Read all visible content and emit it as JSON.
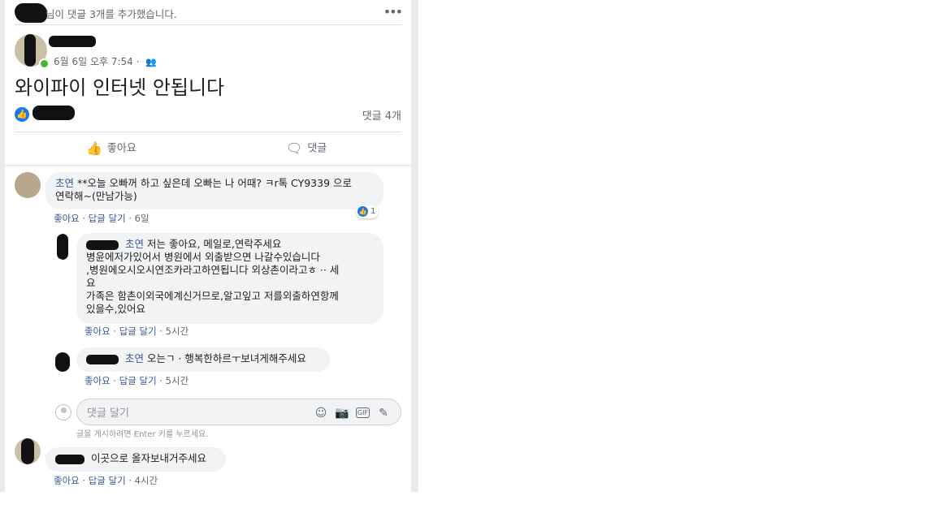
{
  "activity": {
    "text": "님이 댓글 3개를 추가했습니다.",
    "more": "•••"
  },
  "post": {
    "timestamp": "6월 6일 오후 7:54 · ",
    "audience_icon": "friends-icon",
    "text": "와이파이 인터넷 안됩니다",
    "comment_count": "댓글 4개",
    "actions": {
      "like": "좋아요",
      "comment": "댓글"
    }
  },
  "comments": [
    {
      "author": "초연",
      "text_line1": "**오늘 오빠꺼 하고 싶은데 오빠는 나 어때? ㅋr톡 CY9339 으로",
      "text_line2": "연락해~(만남가능)",
      "like": "좋아요",
      "reply": "답글 달기",
      "time": "6일",
      "reaction_count": "1",
      "replies": [
        {
          "mention": "초연",
          "lines": [
            "저는 좋아요, 메일로,연락주세요",
            "병윤에저가있어서 병원에서 외출받으면 나갈수있습니다",
            ",병원에오시오시연조카라고하연됩니다 외상촌이라고ㅎ ·· 세",
            "요",
            "가족은 함촌이외국에계신거므로,알고잎고 저를외출하연항께",
            "있을수,있어요"
          ],
          "like": "좋아요",
          "reply": "답글 달기",
          "time": "5시간"
        },
        {
          "mention": "초연",
          "text": "오는ㄱ · 행복한하르ㅜ보녀게해주세요",
          "like": "좋아요",
          "reply": "답글 달기",
          "time": "5시간"
        }
      ]
    },
    {
      "text": "이곳으로 올자보내거주세요",
      "like": "좋아요",
      "reply": "답글 달기",
      "time": "4시간"
    }
  ],
  "reply_box": {
    "placeholder": "댓글 달기",
    "hint": "글을 게시하려면 Enter 키를 누르세요.",
    "icons": [
      "emoji-icon",
      "camera-icon",
      "gif-icon",
      "sticker-icon"
    ]
  },
  "colors": {
    "link": "#385898",
    "bubble": "#f2f3f5",
    "like_blue": "#1877f2",
    "online": "#42b72a"
  }
}
